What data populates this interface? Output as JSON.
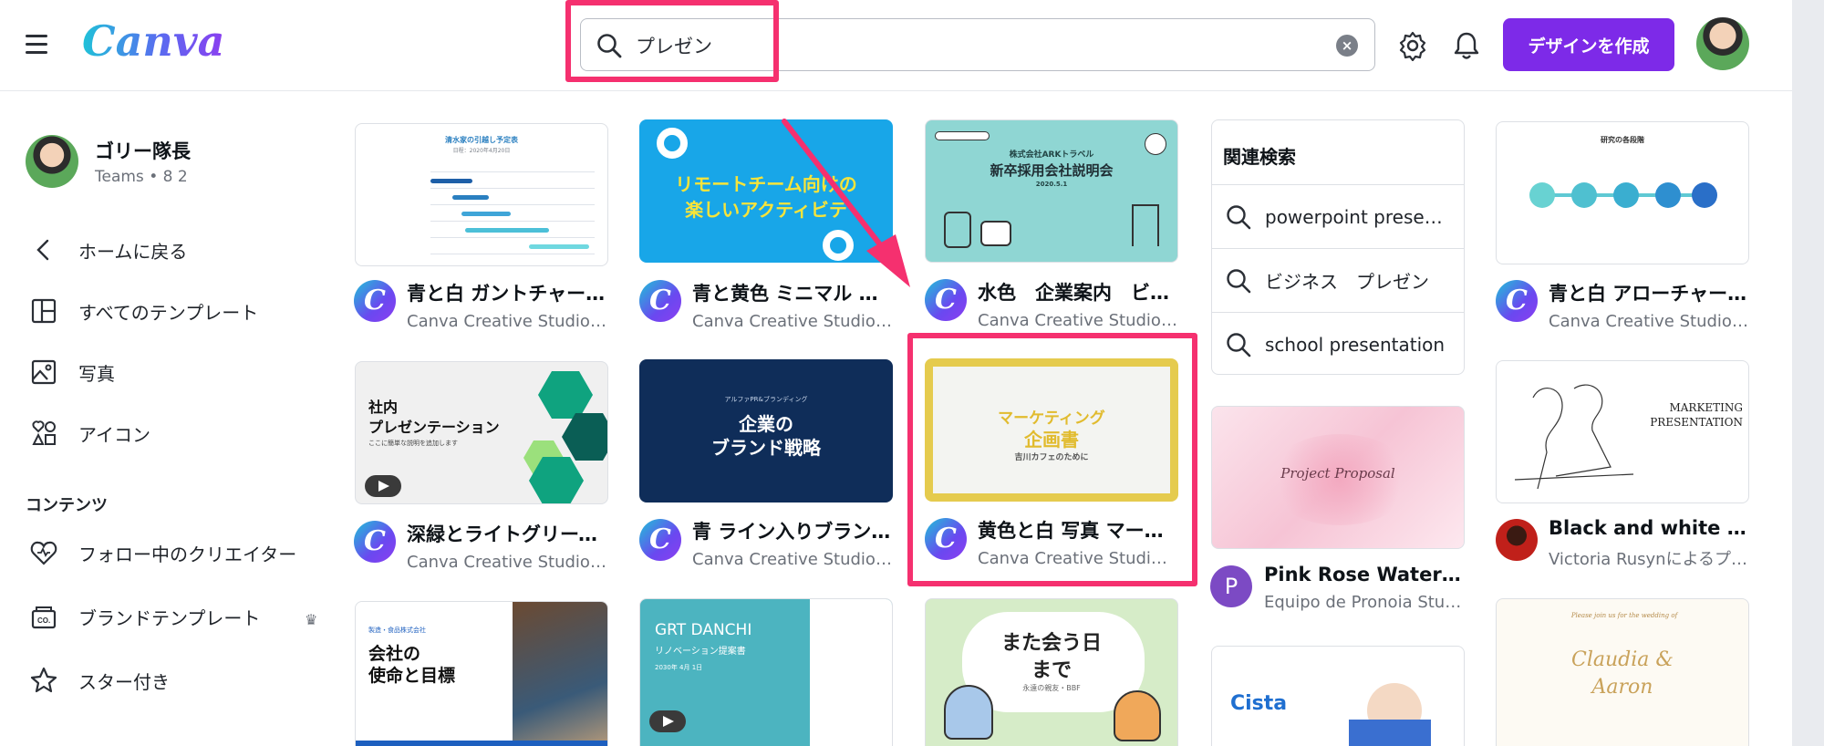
{
  "header": {
    "logo": "Canva",
    "search_value": "プレゼン",
    "create_button": "デザインを作成"
  },
  "sidebar": {
    "user_name": "ゴリー隊長",
    "user_team": "Teams • 8 2",
    "nav": [
      {
        "label": "ホームに戻る",
        "icon": "chevron-left-icon"
      },
      {
        "label": "すべてのテンプレート",
        "icon": "templates-icon"
      },
      {
        "label": "写真",
        "icon": "photo-icon"
      },
      {
        "label": "アイコン",
        "icon": "shapes-icon"
      }
    ],
    "section_title": "コンテンツ",
    "content_nav": [
      {
        "label": "フォロー中のクリエイター",
        "icon": "heart-follow-icon"
      },
      {
        "label": "ブランドテンプレート",
        "icon": "brand-template-icon"
      },
      {
        "label": "スター付き",
        "icon": "star-icon"
      }
    ]
  },
  "templates": [
    {
      "title": "青と白 ガントチャー…",
      "author": "Canva Creative Studioに…",
      "thumb_title": "清水家の引越し予定表",
      "thumb_sub": "日程：2020年4月20日"
    },
    {
      "title": "青と黄色 ミニマル イ…",
      "author": "Canva Creative Studioに…",
      "thumb_title": "リモートチーム向けの",
      "thumb_title2": "楽しいアクティビテ"
    },
    {
      "title": "水色　企業案内　ビジ…",
      "author": "Canva Creative Studioに…",
      "thumb_title": "株式会社ARKトラベル",
      "thumb_title2": "新卒採用会社説明会",
      "thumb_sub": "2020.5.1"
    },
    {
      "title": "青と白 アローチャー…",
      "author": "Canva Creative Studioに…",
      "thumb_title": "研究の各段階"
    },
    {
      "title": "深緑とライトグリーン…",
      "author": "Canva Creative Studioに…",
      "thumb_title": "社内",
      "thumb_title2": "プレゼンテーション",
      "thumb_sub": "ここに簡単な説明を追加します"
    },
    {
      "title": "青 ライン入りブラン…",
      "author": "Canva Creative Studioに…",
      "thumb_title": "企業の",
      "thumb_title2": "ブランド戦略",
      "thumb_sub": "アルファPR&ブランディング"
    },
    {
      "title": "黄色と白 写真 マーケ…",
      "author": "Canva Creative Studioに…",
      "thumb_title": "マーケティング",
      "thumb_title2": "企画書",
      "thumb_sub": "吉川カフェのために"
    },
    {
      "title": "Pink Rose Watercolo…",
      "author": "Equipo de Pronoia Studi…",
      "thumb_title": "Project Proposal",
      "badge": "P"
    },
    {
      "title": "Black and white Mini…",
      "author": "Victoria Rusynによるプ…",
      "thumb_title": "MARKETING",
      "thumb_title2": "PRESENTATION"
    },
    {
      "thumb_title": "会社の",
      "thumb_title2": "使命と目標",
      "thumb_sub": "製造・食品株式会社"
    },
    {
      "thumb_title": "GRT DANCHI",
      "thumb_title2": "リノベーション提案書",
      "thumb_sub": "2030年 4月 1日"
    },
    {
      "thumb_title": "また会う日",
      "thumb_title2": "まで",
      "thumb_sub": "永遠の親友・BBF"
    },
    {
      "thumb_title": "Cista"
    },
    {
      "thumb_title": "Claudia &",
      "thumb_title2": "Aaron",
      "thumb_sub": "Please join us for the wedding of"
    }
  ],
  "related": {
    "title": "関連検索",
    "items": [
      "powerpoint prese…",
      "ビジネス　プレゼン",
      "school presentation"
    ]
  },
  "colors": {
    "brand_purple": "#7d2ae8",
    "highlight_pink": "#f5306f"
  }
}
